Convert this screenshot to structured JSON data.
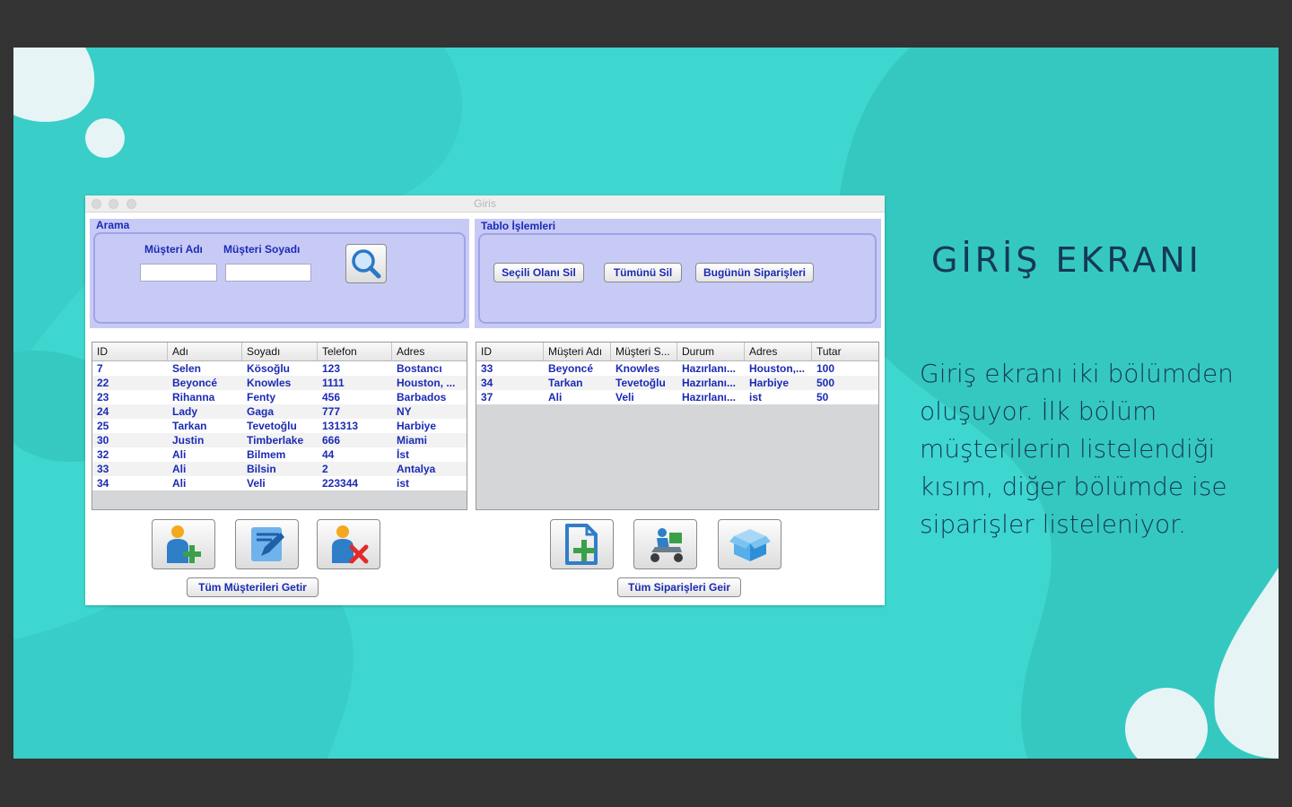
{
  "window": {
    "title": "Giris"
  },
  "search_panel": {
    "title": "Arama",
    "name_label": "Müşteri Adı",
    "surname_label": "Müşteri Soyadı",
    "name_value": "",
    "surname_value": "",
    "search_icon": "search-icon"
  },
  "table_ops_panel": {
    "title": "Tablo İşlemleri",
    "delete_selected": "Seçili Olanı Sil",
    "delete_all": "Tümünü Sil",
    "todays_orders": "Bugünün Siparişleri"
  },
  "customers": {
    "columns": [
      "ID",
      "Adı",
      "Soyadı",
      "Telefon",
      "Adres"
    ],
    "rows": [
      [
        "7",
        "Selen",
        "Kösoğlu",
        "123",
        "Bostancı"
      ],
      [
        "22",
        "Beyoncé",
        "Knowles",
        "1111",
        "Houston, ..."
      ],
      [
        "23",
        "Rihanna",
        "Fenty",
        "456",
        "Barbados"
      ],
      [
        "24",
        "Lady",
        "Gaga",
        "777",
        "NY"
      ],
      [
        "25",
        "Tarkan",
        "Tevetoğlu",
        "131313",
        "Harbiye"
      ],
      [
        "30",
        "Justin",
        "Timberlake",
        "666",
        "Miami"
      ],
      [
        "32",
        "Ali",
        "Bilmem",
        "44",
        "İst"
      ],
      [
        "33",
        "Ali",
        "Bilsin",
        "2",
        "Antalya"
      ],
      [
        "34",
        "Ali",
        "Veli",
        "223344",
        "ist"
      ]
    ]
  },
  "orders": {
    "columns": [
      "ID",
      "Müşteri Adı",
      "Müşteri S...",
      "Durum",
      "Adres",
      "Tutar"
    ],
    "rows": [
      [
        "33",
        "Beyoncé",
        "Knowles",
        "Hazırlanı...",
        "Houston,...",
        "100"
      ],
      [
        "34",
        "Tarkan",
        "Tevetoğlu",
        "Hazırlanı...",
        "Harbiye",
        "500"
      ],
      [
        "37",
        "Ali",
        "Veli",
        "Hazırlanı...",
        "ist",
        "50"
      ]
    ]
  },
  "customer_actions": {
    "add_icon": "add-user-icon",
    "edit_icon": "edit-icon",
    "delete_icon": "delete-user-icon",
    "get_all": "Tüm Müşterileri Getir"
  },
  "order_actions": {
    "add_icon": "add-document-icon",
    "delivery_icon": "delivery-scooter-icon",
    "package_icon": "package-box-icon",
    "get_all": "Tüm Siparişleri Geir"
  },
  "slide": {
    "heading": "GİRİŞ EKRANI",
    "body": "Giriş ekranı iki bölümden oluşuyor. İlk bölüm müşterilerin listelendiği kısım, diğer bölümde ise siparişler listeleniyor."
  },
  "colors": {
    "background": "#3ed7cf",
    "heading": "#16385a",
    "panel": "#c8caf6",
    "table_text": "#1b2bb4"
  }
}
